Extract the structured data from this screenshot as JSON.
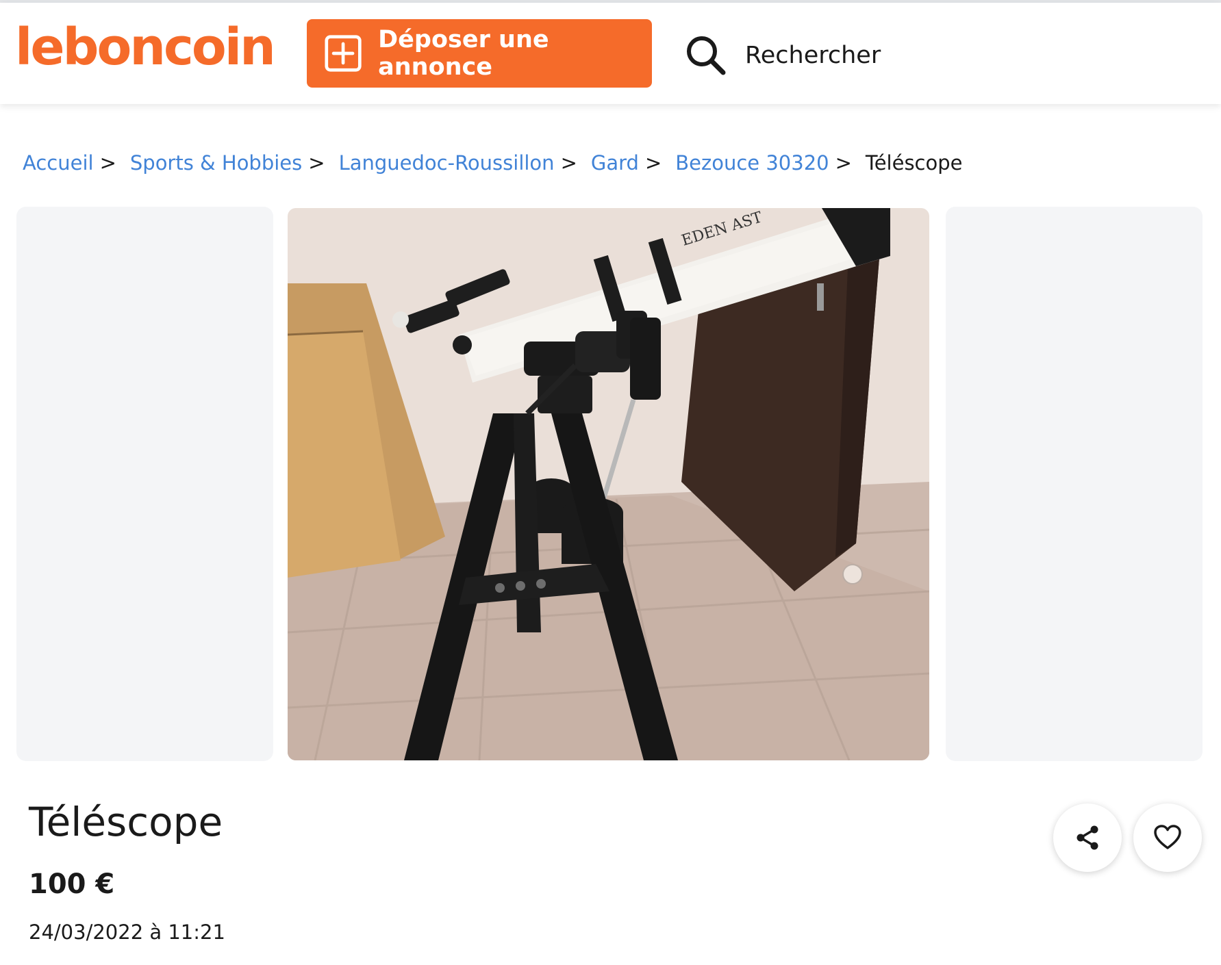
{
  "header": {
    "logo_text": "leboncoin",
    "post_button_label": "Déposer une annonce",
    "search_label": "Rechercher",
    "brand_color": "#f56b2a"
  },
  "breadcrumb": {
    "items": [
      "Accueil",
      "Sports & Hobbies",
      "Languedoc-Roussillon",
      "Gard",
      "Bezouce 30320"
    ],
    "current": "Téléscope",
    "separator": ">",
    "link_color": "#4183d7"
  },
  "photo": {
    "tube_text": "EDEN AST"
  },
  "listing": {
    "title": "Téléscope",
    "price": "100 €",
    "date": "24/03/2022 à 11:21"
  },
  "actions": {
    "share_icon": "share-icon",
    "favorite_icon": "heart-icon"
  }
}
